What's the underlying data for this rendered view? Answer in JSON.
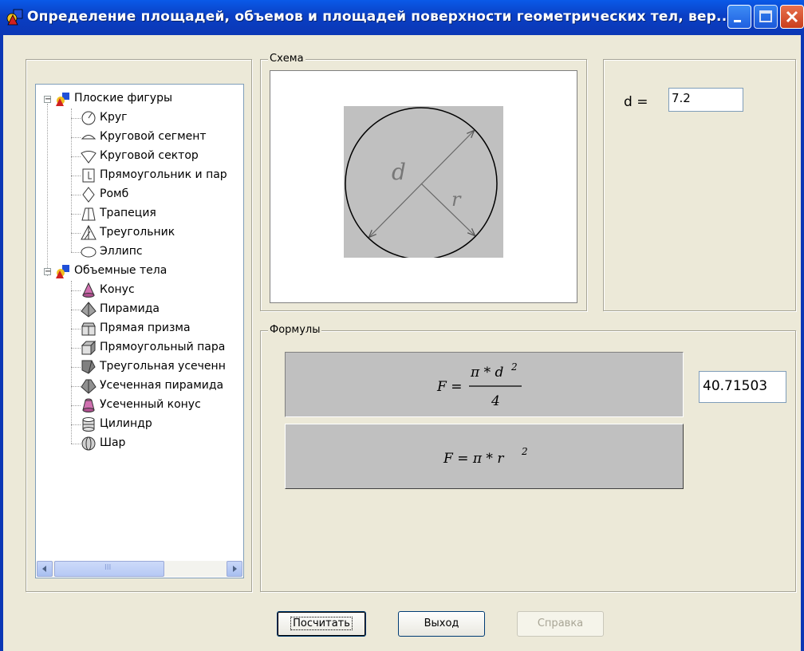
{
  "window": {
    "title": "Определение площадей, объемов и площадей поверхности геометрических тел, вер..."
  },
  "tree": {
    "groups": [
      {
        "label": "Плоские фигуры",
        "icon": "flat-shapes-icon",
        "items": [
          {
            "label": "Круг",
            "icon": "circle-icon"
          },
          {
            "label": "Круговой сегмент",
            "icon": "circular-segment-icon"
          },
          {
            "label": "Круговой сектор",
            "icon": "circular-sector-icon"
          },
          {
            "label": "Прямоугольник и пар",
            "icon": "rectangle-icon"
          },
          {
            "label": "Ромб",
            "icon": "rhombus-icon"
          },
          {
            "label": "Трапеция",
            "icon": "trapezoid-icon"
          },
          {
            "label": "Треугольник",
            "icon": "triangle-icon"
          },
          {
            "label": "Эллипс",
            "icon": "ellipse-icon"
          }
        ]
      },
      {
        "label": "Объемные тела",
        "icon": "solid-bodies-icon",
        "items": [
          {
            "label": "Конус",
            "icon": "cone-icon"
          },
          {
            "label": "Пирамида",
            "icon": "pyramid-icon"
          },
          {
            "label": "Прямая призма",
            "icon": "prism-icon"
          },
          {
            "label": "Прямоугольный пара",
            "icon": "cuboid-icon"
          },
          {
            "label": "Треугольная усеченн",
            "icon": "truncated-prism-icon"
          },
          {
            "label": "Усеченная пирамида",
            "icon": "truncated-pyramid-icon"
          },
          {
            "label": "Усеченный конус",
            "icon": "truncated-cone-icon"
          },
          {
            "label": "Цилиндр",
            "icon": "cylinder-icon"
          },
          {
            "label": "Шар",
            "icon": "sphere-icon"
          }
        ]
      }
    ],
    "scroll_grip": "III"
  },
  "scheme": {
    "label": "Схема",
    "d_label": "d",
    "r_label": "r"
  },
  "params": {
    "d_label": "d =",
    "d_value": "7.2"
  },
  "formulas": {
    "label": "Формулы",
    "f1": {
      "lhs": "F =",
      "numerator": "π * d",
      "exp": "2",
      "denominator": "4"
    },
    "f2": {
      "lhs": "F = π * r",
      "exp": "2"
    },
    "result": "40.71503"
  },
  "buttons": {
    "calculate": "Посчитать",
    "exit": "Выход",
    "help": "Справка"
  },
  "colors": {
    "titlebar": "#0b37b5",
    "panel": "#ece9d8",
    "formula_bg": "#c0c0c0"
  }
}
